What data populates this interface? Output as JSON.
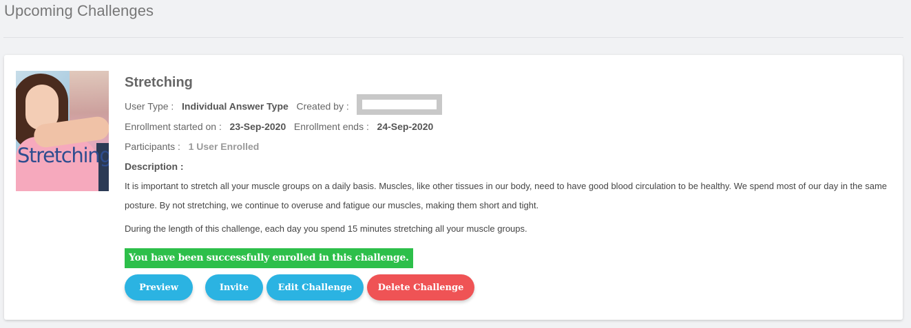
{
  "page": {
    "title": "Upcoming Challenges"
  },
  "challenge": {
    "thumbnail_text": "Stretching",
    "name": "Stretching",
    "user_type_label": "User Type :",
    "user_type_value": "Individual Answer Type",
    "created_by_label": "Created by :",
    "enroll_start_label": "Enrollment started on :",
    "enroll_start_value": "23-Sep-2020",
    "enroll_end_label": "Enrollment ends :",
    "enroll_end_value": "24-Sep-2020",
    "participants_label": "Participants :",
    "participants_value": "1 User Enrolled",
    "description_label": "Description :",
    "description_p1": "It is important to stretch all your muscle groups on a daily basis. Muscles, like other tissues in our body, need to have good blood circulation to be healthy.  We spend most of our day in the same posture.  By not stretching, we continue to overuse and fatigue our muscles, making them short and tight.",
    "description_p2": "During the length of this challenge, each day you spend 15 minutes stretching all your muscle groups.",
    "enrolled_message": "You have been successfully enrolled in this challenge."
  },
  "actions": {
    "preview": "Preview",
    "invite": "Invite",
    "edit": "Edit Challenge",
    "delete": "Delete Challenge"
  },
  "colors": {
    "primary_button": "#2bb3e2",
    "danger_button": "#ef5355",
    "success_banner": "#2dbf4a"
  }
}
